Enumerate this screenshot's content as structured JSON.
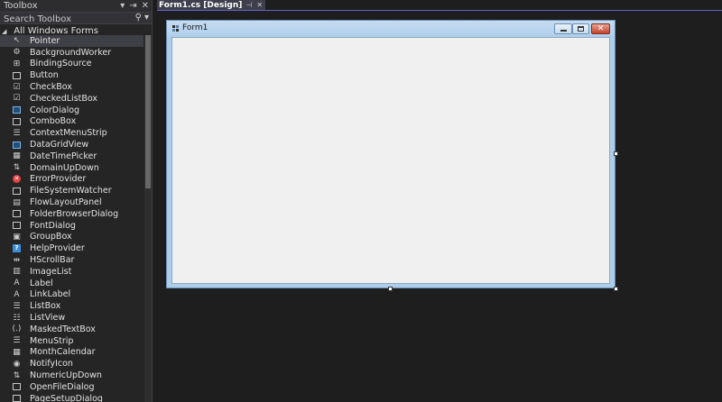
{
  "toolbox": {
    "title": "Toolbox",
    "controls": [
      "▾",
      "⇥",
      "✕"
    ],
    "search_placeholder": "Search Toolbox",
    "group_label": "All Windows Forms",
    "items": [
      {
        "label": "Pointer",
        "icon": "pointer-icon",
        "selected": true
      },
      {
        "label": "BackgroundWorker",
        "icon": "background-worker-icon"
      },
      {
        "label": "BindingSource",
        "icon": "binding-source-icon"
      },
      {
        "label": "Button",
        "icon": "button-icon"
      },
      {
        "label": "CheckBox",
        "icon": "checkbox-icon"
      },
      {
        "label": "CheckedListBox",
        "icon": "checked-listbox-icon"
      },
      {
        "label": "ColorDialog",
        "icon": "color-dialog-icon"
      },
      {
        "label": "ComboBox",
        "icon": "combobox-icon"
      },
      {
        "label": "ContextMenuStrip",
        "icon": "context-menu-strip-icon"
      },
      {
        "label": "DataGridView",
        "icon": "datagridview-icon"
      },
      {
        "label": "DateTimePicker",
        "icon": "datetimepicker-icon"
      },
      {
        "label": "DomainUpDown",
        "icon": "domain-updown-icon"
      },
      {
        "label": "ErrorProvider",
        "icon": "error-provider-icon"
      },
      {
        "label": "FileSystemWatcher",
        "icon": "filesystem-watcher-icon"
      },
      {
        "label": "FlowLayoutPanel",
        "icon": "flow-layout-panel-icon"
      },
      {
        "label": "FolderBrowserDialog",
        "icon": "folder-browser-dialog-icon"
      },
      {
        "label": "FontDialog",
        "icon": "font-dialog-icon"
      },
      {
        "label": "GroupBox",
        "icon": "groupbox-icon"
      },
      {
        "label": "HelpProvider",
        "icon": "help-provider-icon"
      },
      {
        "label": "HScrollBar",
        "icon": "hscrollbar-icon"
      },
      {
        "label": "ImageList",
        "icon": "imagelist-icon"
      },
      {
        "label": "Label",
        "icon": "label-icon"
      },
      {
        "label": "LinkLabel",
        "icon": "linklabel-icon"
      },
      {
        "label": "ListBox",
        "icon": "listbox-icon"
      },
      {
        "label": "ListView",
        "icon": "listview-icon"
      },
      {
        "label": "MaskedTextBox",
        "icon": "masked-textbox-icon"
      },
      {
        "label": "MenuStrip",
        "icon": "menustrip-icon"
      },
      {
        "label": "MonthCalendar",
        "icon": "month-calendar-icon"
      },
      {
        "label": "NotifyIcon",
        "icon": "notify-icon-icon"
      },
      {
        "label": "NumericUpDown",
        "icon": "numeric-updown-icon"
      },
      {
        "label": "OpenFileDialog",
        "icon": "open-file-dialog-icon"
      },
      {
        "label": "PageSetupDialog",
        "icon": "page-setup-dialog-icon"
      }
    ]
  },
  "tab": {
    "label": "Form1.cs [Design]",
    "pin_glyph": "⊣",
    "close_glyph": "✕"
  },
  "form": {
    "title": "Form1",
    "close_glyph": "✕"
  },
  "colors": {
    "accent": "#6464c8",
    "close_button": "#c2422c",
    "form_client": "#f0f0f0"
  }
}
